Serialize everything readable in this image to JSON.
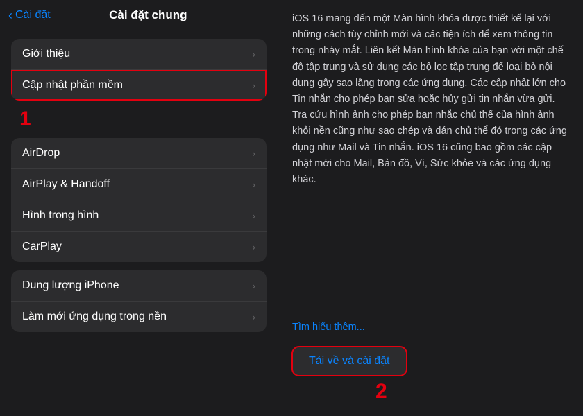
{
  "header": {
    "back_label": "Cài đặt",
    "title": "Cài đặt chung"
  },
  "left": {
    "group1": {
      "items": [
        {
          "label": "Giới thiệu",
          "id": "gioi-thieu"
        },
        {
          "label": "Cập nhật phần mềm",
          "id": "cap-nhat-phan-mem",
          "highlighted": true
        }
      ]
    },
    "group2": {
      "items": [
        {
          "label": "AirDrop",
          "id": "airdrop"
        },
        {
          "label": "AirPlay & Handoff",
          "id": "airplay-handoff"
        },
        {
          "label": "Hình trong hình",
          "id": "hinh-trong-hinh"
        },
        {
          "label": "CarPlay",
          "id": "carplay"
        }
      ]
    },
    "group3": {
      "items": [
        {
          "label": "Dung lượng iPhone",
          "id": "dung-luong-iphone"
        },
        {
          "label": "Làm mới ứng dụng trong nền",
          "id": "lam-moi-ung-dung"
        }
      ]
    },
    "annotation1": "1"
  },
  "right": {
    "description": "iOS 16 mang đến một Màn hình khóa được thiết kế lại với những cách tùy chỉnh mới và các tiện ích để xem thông tin trong nháy mắt. Liên kết Màn hình khóa của bạn với một chế độ tập trung và sử dụng các bộ lọc tập trung để loại bỏ nội dung gây sao lãng trong các ứng dụng. Các cập nhật lớn cho Tin nhắn cho phép bạn sửa hoặc hủy gửi tin nhắn vừa gửi. Tra cứu hình ảnh cho phép bạn nhắc chủ thể của hình ảnh khỏi nền cũng như sao chép và dán chủ thể đó trong các ứng dụng như Mail và Tin nhắn. iOS 16 cũng bao gồm các cập nhật mới cho Mail, Bản đồ, Ví, Sức khỏe và các ứng dụng khác.",
    "learn_more": "Tìm hiểu thêm...",
    "download_btn": "Tải về và cài đặt",
    "annotation2": "2"
  }
}
